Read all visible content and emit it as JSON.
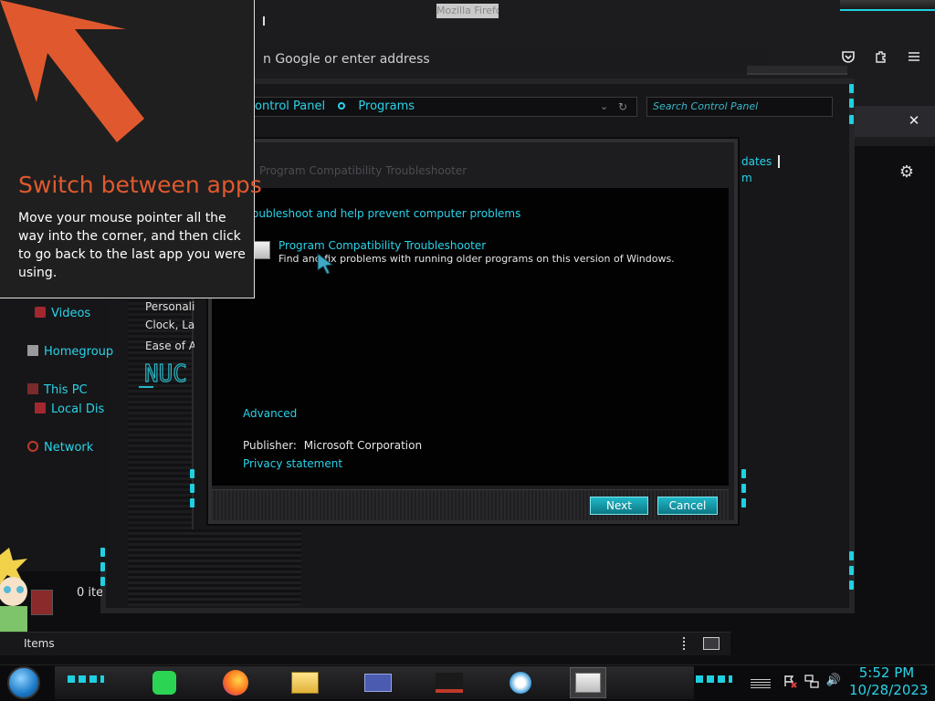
{
  "firefox": {
    "title": "Mozilla Firefox",
    "url_placeholder": "n Google or enter address",
    "toolbar_icons": [
      "pocket-icon",
      "extensions-icon",
      "menu-icon"
    ],
    "notification_close": "✕",
    "settings_icon": "gear-icon"
  },
  "control_panel": {
    "breadcrumb": [
      "ontrol Panel",
      "Programs"
    ],
    "search_placeholder": "Search Control Panel",
    "left_items": [
      "Personaliz",
      "Clock, Lar",
      "Ease of Ac"
    ],
    "right_partial": [
      "dates",
      "m"
    ],
    "status_items": "Items"
  },
  "nav": {
    "items": [
      {
        "label": "Videos",
        "icon": "videos-icon"
      },
      {
        "label": "Homegroup",
        "icon": "homegroup-icon"
      },
      {
        "label": "This PC",
        "icon": "pc-icon"
      },
      {
        "label": "Local Dis",
        "icon": "disk-icon"
      },
      {
        "label": "Network",
        "icon": "network-icon"
      }
    ],
    "items_count": "0 ite"
  },
  "dialog": {
    "title": "Program Compatibility Troubleshooter",
    "heading": "oubleshoot and help prevent computer problems",
    "item_title": "Program Compatibility Troubleshooter",
    "item_desc": "Find and fix problems with running older programs on this version of Windows.",
    "advanced": "Advanced",
    "publisher_label": "Publisher:",
    "publisher_value": "Microsoft Corporation",
    "privacy": "Privacy statement",
    "next_label": "Next",
    "cancel_label": "Cancel"
  },
  "tip": {
    "title": "Switch between apps",
    "body": "Move your mouse pointer all the way into the corner, and then click to go back to the last app you were using."
  },
  "taskbar": {
    "apps": [
      "spotify-icon",
      "firefox-icon",
      "file-explorer-icon",
      "control-panel-icon",
      "game-icon",
      "weather-icon",
      "troubleshooter-icon"
    ],
    "time": "5:52 PM",
    "date": "10/28/2023"
  },
  "colors": {
    "accent": "#29d3e8",
    "tip_title": "#e0592e",
    "tip_arrow": "#e0592e"
  }
}
